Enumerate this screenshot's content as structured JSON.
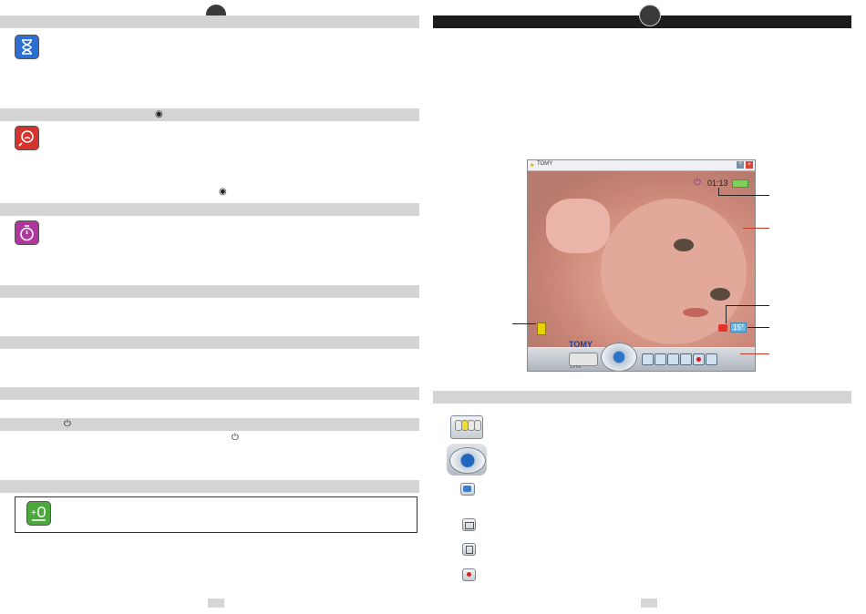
{
  "app": {
    "title": "TOMY",
    "brand": "TOMY",
    "timer": "01:13",
    "badge": "15°",
    "help_btn": "?",
    "close_btn": "×",
    "camera_numbers": "1 2 3 4"
  },
  "colors": {
    "bar_light": "#d4d4d4",
    "bar_dark": "#1c1c1c",
    "blue_icon": "#2b6fd6",
    "red_icon": "#d8322c",
    "magenta_icon": "#b0369f",
    "green_icon": "#4aa93a",
    "callout_red": "#c0392b"
  },
  "icons": {
    "hourglass": "hourglass-icon",
    "baby_cry": "baby-cry-icon",
    "timer": "stopwatch-icon",
    "power": "power-icon",
    "add_camera": "add-camera-icon",
    "speaker": "speaker-icon"
  }
}
